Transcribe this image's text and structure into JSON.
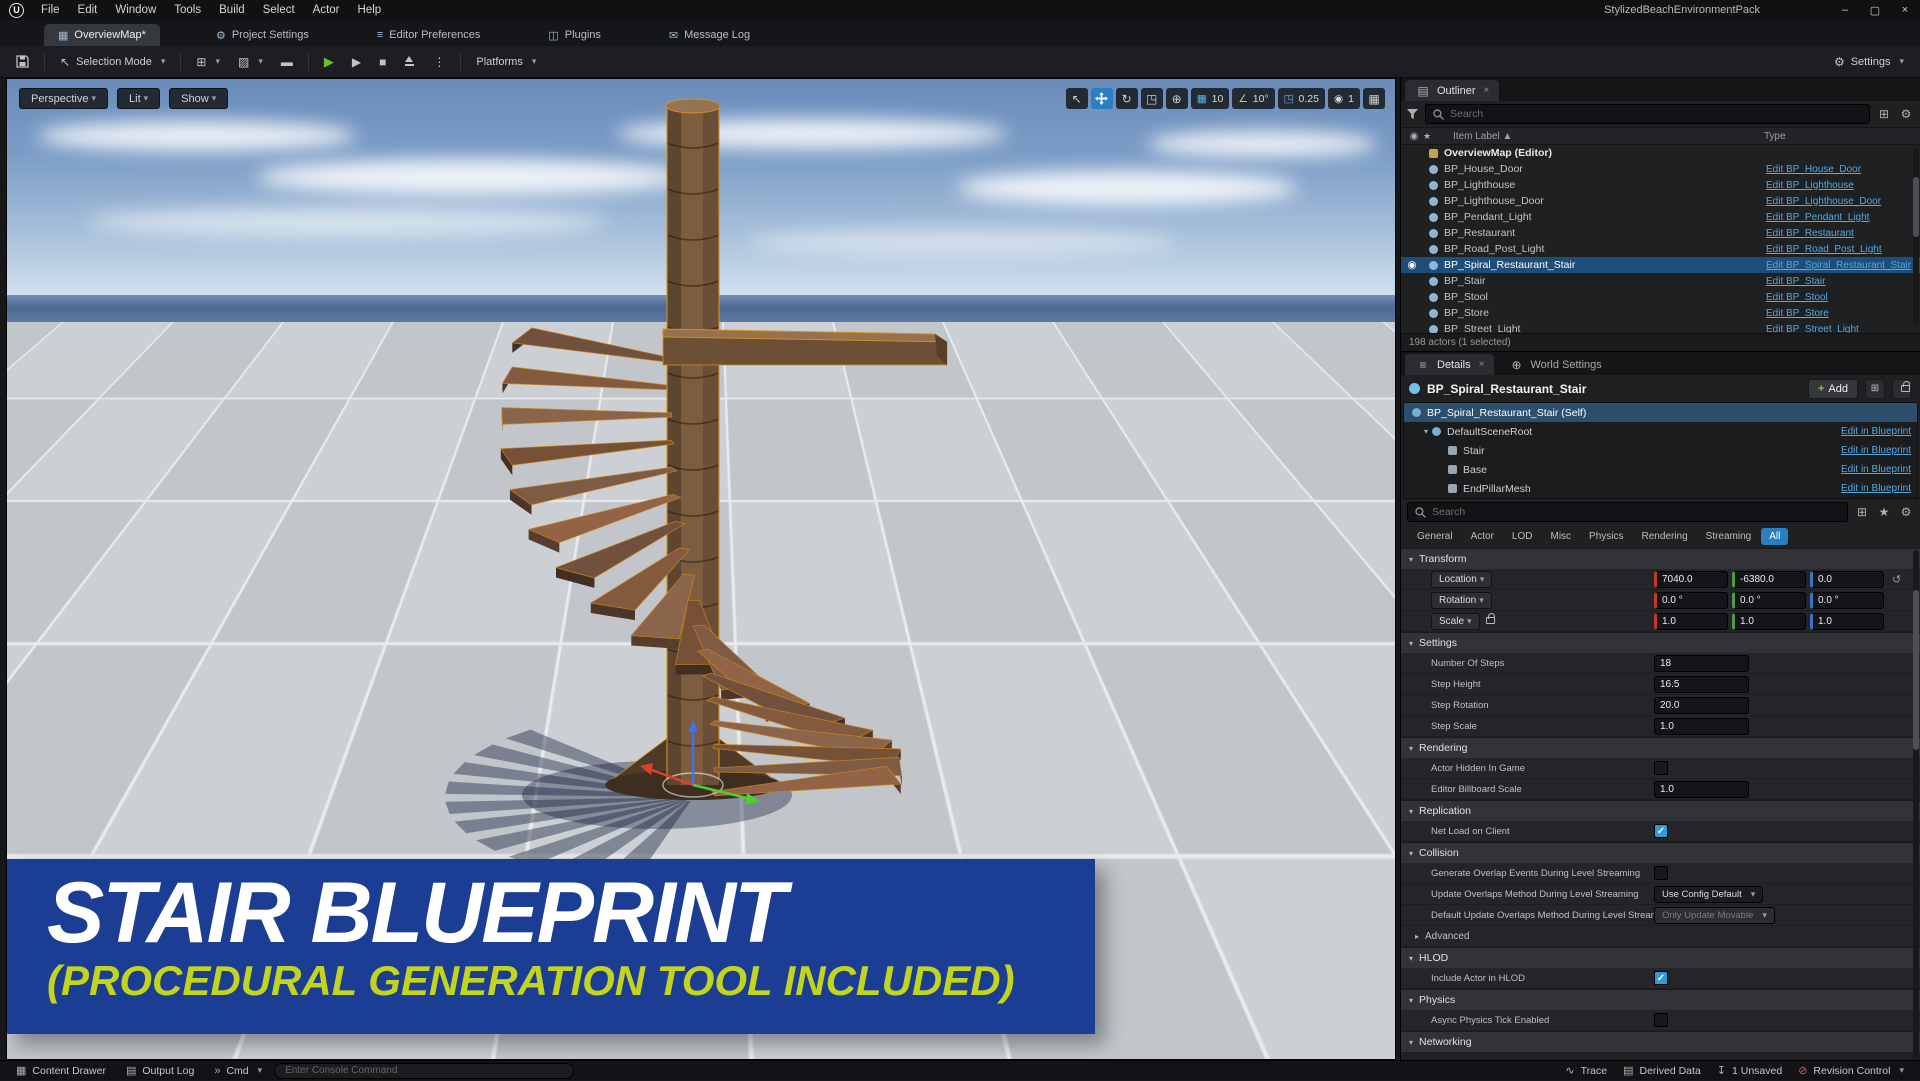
{
  "icons": {
    "logo": "U",
    "minimize": "–",
    "maximize": "▢",
    "close": "×",
    "tab_level": "▦",
    "gear": "⚙",
    "sliders": "≡",
    "plugin": "◫",
    "envelope": "✉",
    "cursor": "↖",
    "cube_add": "⊞",
    "brush": "▨",
    "clapper": "▬",
    "play": "▶",
    "frame_skip": "▶",
    "stop": "■",
    "kebab": "⋮",
    "rotate": "↻",
    "globe": "⊕",
    "grid": "▦",
    "angle": "∠",
    "scale_snap": "◳",
    "camera": "◉",
    "star": "★",
    "plus": "+",
    "reset": "↺",
    "eye": "◉",
    "world": "▲",
    "content_drawer": "▦",
    "output_log": "▤",
    "cmd_arrow": "»",
    "trace": "∿",
    "derived_data": "▤",
    "unsaved": "↧",
    "revision": "⊘"
  },
  "menu_bar": {
    "menus": [
      "File",
      "Edit",
      "Window",
      "Tools",
      "Build",
      "Select",
      "Actor",
      "Help"
    ],
    "project_name": "StylizedBeachEnvironmentPack"
  },
  "tab_bar": {
    "active_tab": "OverviewMap*",
    "buttons": [
      "Project Settings",
      "Editor Preferences",
      "Plugins",
      "Message Log"
    ]
  },
  "toolbar": {
    "selection_mode": "Selection Mode",
    "platforms": "Platforms",
    "settings_label": "Settings"
  },
  "viewport": {
    "buttons": [
      "Perspective",
      "Lit",
      "Show"
    ],
    "snaps": {
      "grid": "10",
      "angle": "10°",
      "scale": "0.25",
      "camera": "1"
    },
    "banner": {
      "title": "STAIR BLUEPRINT",
      "subtitle": "(PROCEDURAL GENERATION TOOL INCLUDED)"
    }
  },
  "outliner": {
    "title": "Outliner",
    "search_placeholder": "Search",
    "columns": {
      "label": "Item Label ▲",
      "type": "Type"
    },
    "root": "OverviewMap (Editor)",
    "rows": [
      {
        "label": "BP_House_Door",
        "type": "Edit BP_House_Door",
        "selected": false
      },
      {
        "label": "BP_Lighthouse",
        "type": "Edit BP_Lighthouse",
        "selected": false
      },
      {
        "label": "BP_Lighthouse_Door",
        "type": "Edit BP_Lighthouse_Door",
        "selected": false
      },
      {
        "label": "BP_Pendant_Light",
        "type": "Edit BP_Pendant_Light",
        "selected": false
      },
      {
        "label": "BP_Restaurant",
        "type": "Edit BP_Restaurant",
        "selected": false
      },
      {
        "label": "BP_Road_Post_Light",
        "type": "Edit BP_Road_Post_Light",
        "selected": false
      },
      {
        "label": "BP_Spiral_Restaurant_Stair",
        "type": "Edit BP_Spiral_Restaurant_Stair",
        "selected": true
      },
      {
        "label": "BP_Stair",
        "type": "Edit BP_Stair",
        "selected": false
      },
      {
        "label": "BP_Stool",
        "type": "Edit BP_Stool",
        "selected": false
      },
      {
        "label": "BP_Store",
        "type": "Edit BP_Store",
        "selected": false
      },
      {
        "label": "BP_Street_Light",
        "type": "Edit BP_Street_Light",
        "selected": false
      }
    ],
    "status": "198 actors (1 selected)"
  },
  "details": {
    "tabs": [
      "Details",
      "World Settings"
    ],
    "title": "BP_Spiral_Restaurant_Stair",
    "add_label": "Add",
    "edit_link": "Edit in Blueprint",
    "components": [
      {
        "name": "BP_Spiral_Restaurant_Stair (Self)"
      },
      {
        "name": "DefaultSceneRoot"
      },
      {
        "name": "Stair"
      },
      {
        "name": "Base"
      },
      {
        "name": "EndPillarMesh"
      }
    ],
    "search_placeholder": "Search",
    "filters": [
      "General",
      "Actor",
      "LOD",
      "Misc",
      "Physics",
      "Rendering",
      "Streaming",
      "All"
    ],
    "active_filter": "All",
    "transform": {
      "section": "Transform",
      "location": {
        "label": "Location",
        "x": "7040.0",
        "y": "-6380.0",
        "z": "0.0"
      },
      "rotation": {
        "label": "Rotation",
        "x": "0.0 °",
        "y": "0.0 °",
        "z": "0.0 °"
      },
      "scale": {
        "label": "Scale",
        "x": "1.0",
        "y": "1.0",
        "z": "1.0"
      }
    },
    "settings": {
      "section": "Settings",
      "rows": [
        {
          "label": "Number Of Steps",
          "value": "18"
        },
        {
          "label": "Step Height",
          "value": "16.5"
        },
        {
          "label": "Step Rotation",
          "value": "20.0"
        },
        {
          "label": "Step Scale",
          "value": "1.0"
        }
      ]
    },
    "rendering": {
      "section": "Rendering",
      "hidden_label": "Actor Hidden In Game",
      "hidden_checked": false,
      "billboard_label": "Editor Billboard Scale",
      "billboard_value": "1.0"
    },
    "replication": {
      "section": "Replication",
      "net_load_label": "Net Load on Client",
      "net_load_checked": true
    },
    "collision": {
      "section": "Collision",
      "gen_label": "Generate Overlap Events During Level Streaming",
      "gen_checked": false,
      "update_label": "Update Overlaps Method During Level Streaming",
      "update_value": "Use Config Default",
      "default_label": "Default Update Overlaps Method During Level Streaming",
      "default_value": "Only Update Movable"
    },
    "advanced_label": "Advanced",
    "hlod": {
      "section": "HLOD",
      "include_label": "Include Actor in HLOD",
      "include_checked": true
    },
    "physics": {
      "section": "Physics",
      "async_label": "Async Physics Tick Enabled",
      "async_checked": false
    },
    "networking_label": "Networking"
  },
  "status_bar": {
    "content_drawer": "Content Drawer",
    "output_log": "Output Log",
    "cmd": "Cmd",
    "console_placeholder": "Enter Console Command",
    "trace": "Trace",
    "derived_data": "Derived Data",
    "unsaved": "1 Unsaved",
    "revision_control": "Revision Control"
  }
}
